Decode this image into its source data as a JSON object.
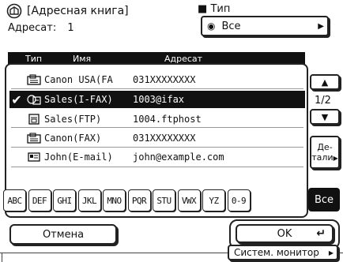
{
  "title": "[Адресная книга]",
  "recipient_label": "Адресат:",
  "recipient_count": "1",
  "type_label": "Тип",
  "type_value": "Все",
  "columns": {
    "type": "Тип",
    "name": "Имя",
    "address": "Адресат"
  },
  "rows": [
    {
      "checked": false,
      "icon": "fax-icon",
      "name": "Canon USA(FA",
      "address": "031XXXXXXXX"
    },
    {
      "checked": true,
      "icon": "ifax-icon",
      "name": "Sales(I-FAX)",
      "address": "1003@ifax"
    },
    {
      "checked": false,
      "icon": "ftp-icon",
      "name": "Sales(FTP)",
      "address": "1004.ftphost"
    },
    {
      "checked": false,
      "icon": "fax-icon",
      "name": "Canon(FAX)",
      "address": "031XXXXXXXX"
    },
    {
      "checked": false,
      "icon": "email-icon",
      "name": "John(E-mail)",
      "address": "john@example.com"
    }
  ],
  "page_indicator": "1/2",
  "details_label_1": "Де-",
  "details_label_2": "тали",
  "keys": [
    "ABC",
    "DEF",
    "GHI",
    "JKL",
    "MNO",
    "PQR",
    "STU",
    "VWX",
    "YZ",
    "0-9"
  ],
  "all_key": "Все",
  "cancel_label": "Отмена",
  "ok_label": "OK",
  "monitor_label": "Систем. монитор"
}
